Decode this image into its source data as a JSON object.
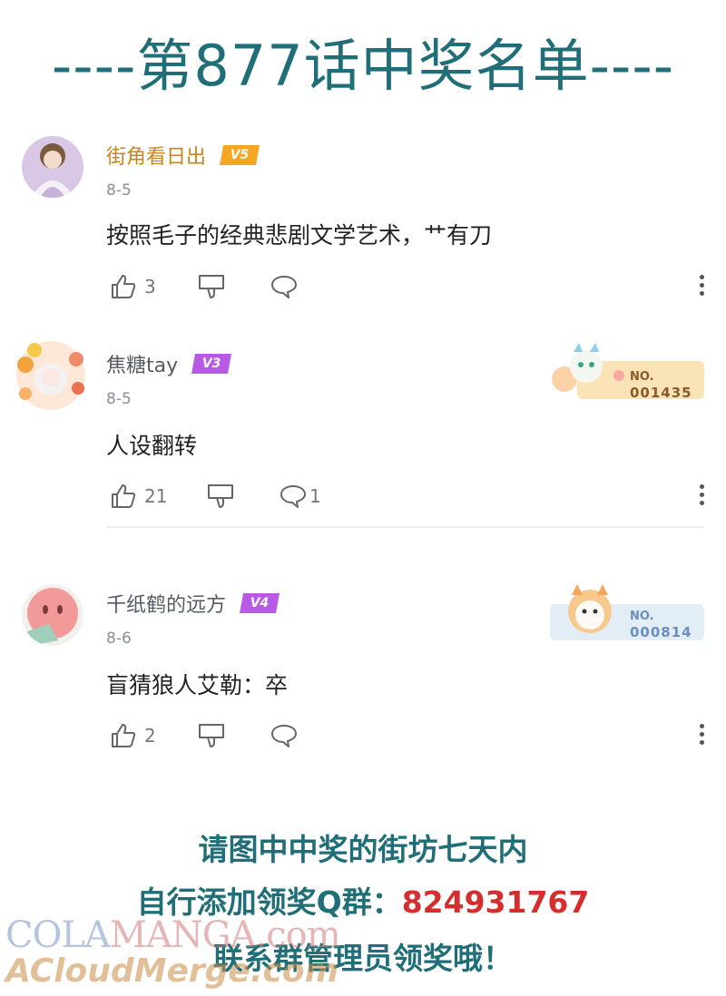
{
  "page": {
    "title": "----第877话中奖名单----"
  },
  "comments": [
    {
      "username": "街角看日出",
      "level": "V5",
      "level_color": "#f5a623",
      "date": "8-5",
      "text": "按照毛子的经典悲剧文学艺术，艹有刀",
      "likes": "3",
      "replies": ""
    },
    {
      "username": "焦糖tay",
      "level": "V3",
      "level_color": "#b85ae6",
      "date": "8-5",
      "text": "人设翻转",
      "likes": "21",
      "replies": "1",
      "fan_card": {
        "label": "NO.",
        "number": "001435"
      }
    },
    {
      "username": "千纸鹤的远方",
      "level": "V4",
      "level_color": "#b85ae6",
      "date": "8-6",
      "text": "盲猜狼人艾勒：卒",
      "likes": "2",
      "replies": "",
      "fan_card": {
        "label": "NO.",
        "number": "000814"
      }
    }
  ],
  "footer": {
    "line1": "请图中中奖的街坊七天内",
    "line2_prefix": "自行添加领奖Q群：",
    "line2_qq": "824931767",
    "line3": "联系群管理员领奖哦！"
  },
  "watermark": {
    "line1_a": "COLA",
    "line1_b": "MANGA",
    "line1_c": ".com",
    "line2": "ACloudMerge.com"
  },
  "icons": [
    "thumb-up-icon",
    "thumb-down-icon",
    "comment-icon",
    "more-vertical-icon"
  ]
}
